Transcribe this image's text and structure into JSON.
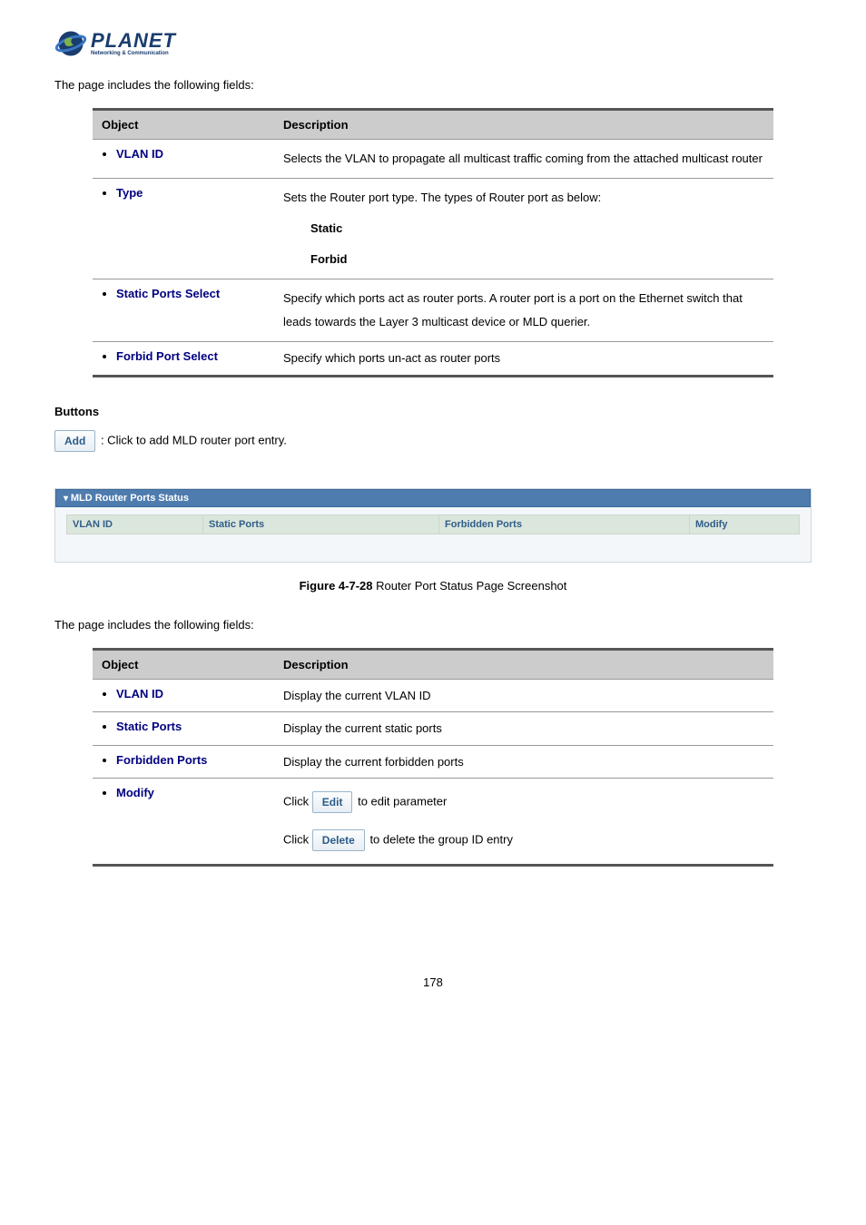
{
  "logo": {
    "name": "PLANET",
    "tagline": "Networking & Communication"
  },
  "intro1": "The page includes the following fields:",
  "table1": {
    "header": {
      "obj": "Object",
      "desc": "Description"
    },
    "rows": [
      {
        "obj": "VLAN ID",
        "desc": "Selects the VLAN to propagate all multicast traffic coming from the attached multicast router"
      },
      {
        "obj": "Type",
        "desc_line": "Sets the Router port type. The types of Router port as below:",
        "opts": [
          "Static",
          "Forbid"
        ]
      },
      {
        "obj": "Static Ports Select",
        "desc": "Specify which ports act as router ports. A router port is a port on the Ethernet switch that leads towards the Layer 3 multicast device or MLD querier."
      },
      {
        "obj": "Forbid Port Select",
        "desc": "Specify which ports un-act as router ports"
      }
    ]
  },
  "buttons_heading": "Buttons",
  "add_btn": "Add",
  "add_text": ": Click to add MLD router port entry.",
  "panel": {
    "title": "MLD Router Ports Status",
    "cols": {
      "c1": "VLAN ID",
      "c2": "Static Ports",
      "c3": "Forbidden Ports",
      "c4": "Modify"
    }
  },
  "figure_caption_strong": "Figure 4-7-28",
  "figure_caption_rest": " Router Port Status Page Screenshot",
  "intro2": "The page includes the following fields:",
  "table2": {
    "header": {
      "obj": "Object",
      "desc": "Description"
    },
    "rows": {
      "vlan": {
        "obj": "VLAN ID",
        "desc": "Display the current VLAN ID"
      },
      "static": {
        "obj": "Static Ports",
        "desc": "Display the current static ports"
      },
      "forbid": {
        "obj": "Forbidden Ports",
        "desc": "Display the current forbidden ports"
      },
      "modify": {
        "obj": "Modify",
        "click1_pre": "Click ",
        "edit_btn": "Edit",
        "click1_post": " to edit parameter",
        "click2_pre": "Click ",
        "del_btn": "Delete",
        "click2_post": " to delete the group ID entry"
      }
    }
  },
  "page_number": "178"
}
